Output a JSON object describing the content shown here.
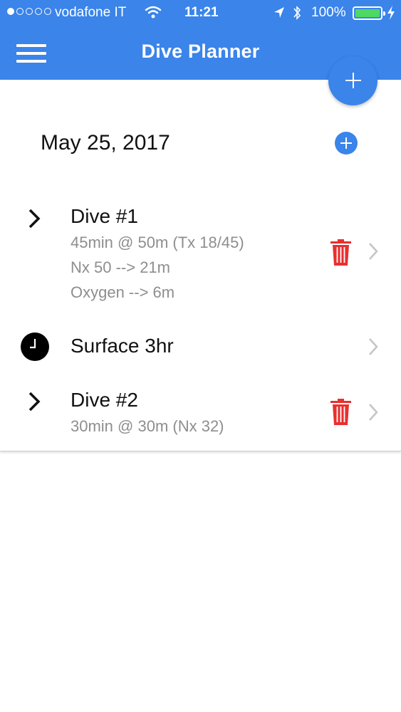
{
  "status_bar": {
    "carrier": "vodafone IT",
    "time": "11:21",
    "battery": "100%"
  },
  "nav": {
    "title": "Dive Planner"
  },
  "plan": {
    "date": "May 25, 2017",
    "items": [
      {
        "type": "dive",
        "title": "Dive #1",
        "details": [
          "45min @ 50m (Tx 18/45)",
          "Nx 50 --> 21m",
          "Oxygen --> 6m"
        ]
      },
      {
        "type": "surface",
        "title": "Surface 3hr"
      },
      {
        "type": "dive",
        "title": "Dive #2",
        "details": [
          "30min @ 30m (Nx 32)"
        ]
      }
    ]
  },
  "colors": {
    "primary": "#3a84ea",
    "trash": "#e8302f",
    "battery": "#4cd964",
    "subtext": "#8e8e8e"
  },
  "icons": [
    "menu-icon",
    "plus-icon",
    "chevron-right-icon",
    "trash-icon",
    "clock-icon",
    "wifi-icon",
    "location-icon",
    "bluetooth-icon",
    "battery-icon"
  ]
}
